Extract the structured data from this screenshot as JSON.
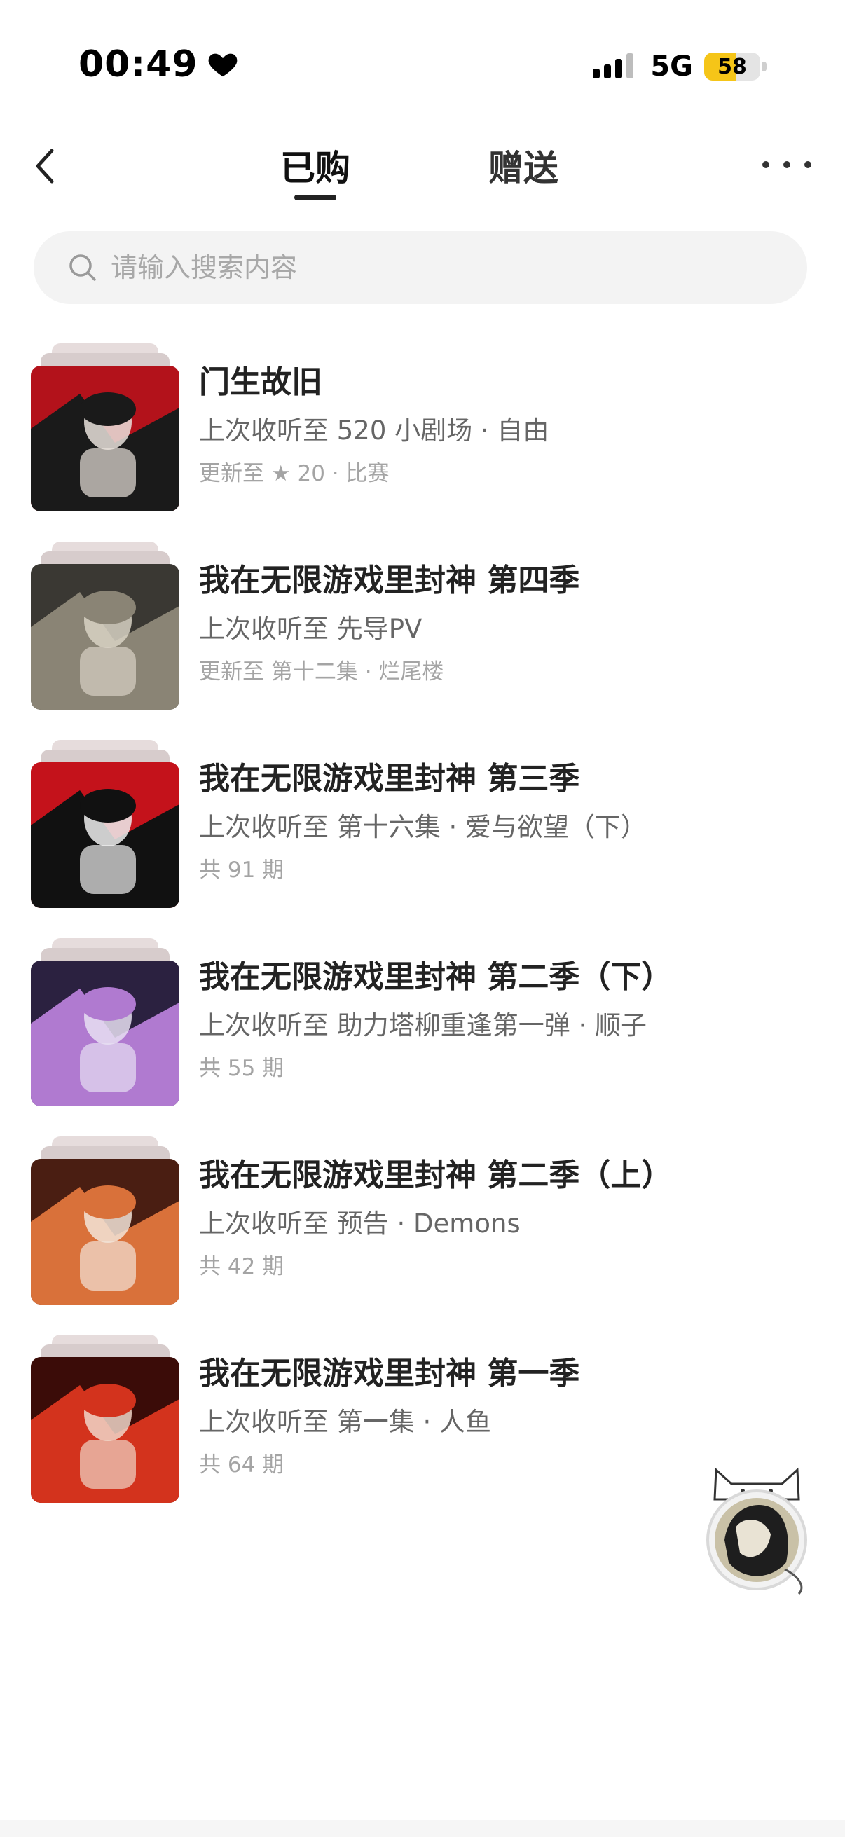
{
  "status_bar": {
    "time": "00:49",
    "network": "5G",
    "battery_level": 58,
    "battery_label": "58",
    "battery_color": "#f5c518"
  },
  "nav": {
    "back_icon": "chevron-left-icon",
    "tabs": [
      {
        "label": "已购",
        "selected": true
      },
      {
        "label": "赠送",
        "selected": false
      }
    ],
    "more_icon": "more-dots-icon"
  },
  "search": {
    "placeholder": "请输入搜索内容",
    "value": ""
  },
  "items": [
    {
      "title": "门生故旧",
      "progress": "上次收听至 520 小剧场 · 自由",
      "meta": "更新至 ★ 20 · 比赛",
      "cover_colors": [
        "#b3121b",
        "#1a1a1a",
        "#e9e2dc"
      ]
    },
    {
      "title": "我在无限游戏里封神 第四季",
      "progress": "上次收听至 先导PV",
      "meta": "更新至 第十二集 · 烂尾楼",
      "cover_colors": [
        "#3a3833",
        "#8a8475",
        "#d8d2c4"
      ]
    },
    {
      "title": "我在无限游戏里封神 第三季",
      "progress": "上次收听至 第十六集 · 爱与欲望（下）",
      "meta": "共 91 期",
      "cover_colors": [
        "#c4121b",
        "#111111",
        "#efefef"
      ]
    },
    {
      "title": "我在无限游戏里封神 第二季（下）",
      "progress": "上次收听至 助力塔柳重逢第一弹 · 顺子",
      "meta": "共 55 期",
      "cover_colors": [
        "#2b2140",
        "#b07ad0",
        "#e7dff2"
      ]
    },
    {
      "title": "我在无限游戏里封神 第二季（上）",
      "progress": "上次收听至 预告 · Demons",
      "meta": "共 42 期",
      "cover_colors": [
        "#4a1e12",
        "#d9713a",
        "#f2e4d8"
      ]
    },
    {
      "title": "我在无限游戏里封神 第一季",
      "progress": "上次收听至 第一集 · 人鱼",
      "meta": "共 64 期",
      "cover_colors": [
        "#3b0c08",
        "#d3331d",
        "#f0d6c8"
      ]
    }
  ],
  "floating": {
    "icon": "mascot-avatar-icon"
  }
}
